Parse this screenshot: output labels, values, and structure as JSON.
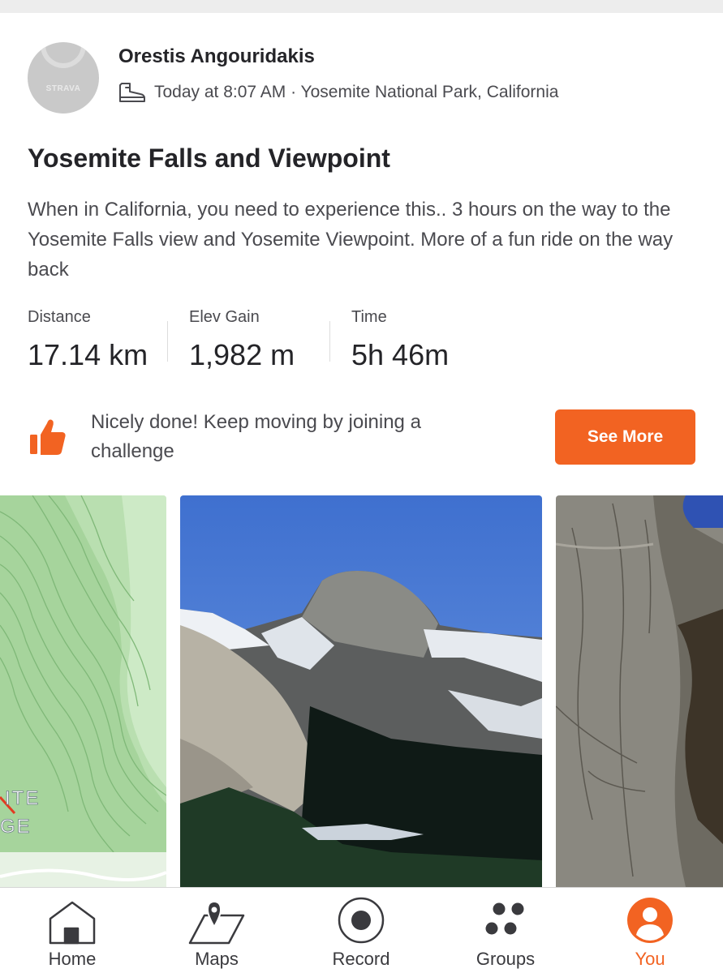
{
  "post": {
    "avatar_brand": "STRAVA",
    "athlete_name": "Orestis Angouridakis",
    "activity_icon": "hiking-boot-icon",
    "meta": "Today at 8:07 AM · Yosemite National Park, California",
    "title": "Yosemite Falls and Viewpoint",
    "description": "When in California, you need to experience this.. 3 hours on the way to the Yosemite Falls view and Yosemite Viewpoint. More of a fun ride on the way back"
  },
  "stats": [
    {
      "label": "Distance",
      "value": "17.14 km"
    },
    {
      "label": "Elev Gain",
      "value": "1,982 m"
    },
    {
      "label": "Time",
      "value": "5h 46m"
    }
  ],
  "challenge": {
    "icon": "thumbs-up-icon",
    "text": "Nicely done! Keep moving by joining a challenge",
    "button_label": "See More"
  },
  "map": {
    "label_line1": "ITE",
    "label_line2": "GE"
  },
  "tabs": [
    {
      "label": "Home",
      "icon": "home-icon",
      "active": false
    },
    {
      "label": "Maps",
      "icon": "map-pin-icon",
      "active": false
    },
    {
      "label": "Record",
      "icon": "record-icon",
      "active": false
    },
    {
      "label": "Groups",
      "icon": "groups-icon",
      "active": false
    },
    {
      "label": "You",
      "icon": "profile-icon",
      "active": true
    }
  ],
  "colors": {
    "accent": "#f26322",
    "text_primary": "#242428",
    "text_secondary": "#4a4a4f"
  }
}
